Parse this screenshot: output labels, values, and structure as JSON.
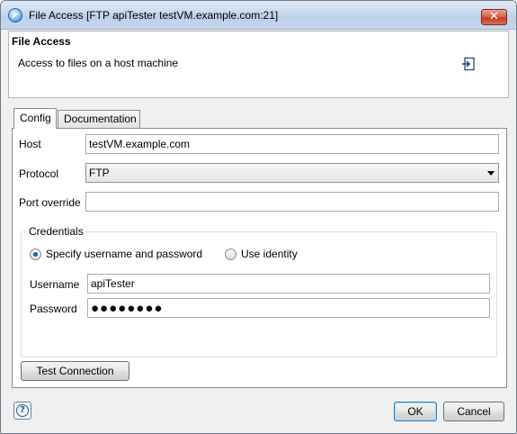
{
  "window": {
    "title": "File Access [FTP apiTester testVM.example.com:21]",
    "close_glyph": "✕"
  },
  "header": {
    "title": "File Access",
    "description": "Access to files on a host machine",
    "icon": "export-icon"
  },
  "tabs": [
    {
      "label": "Config",
      "active": true
    },
    {
      "label": "Documentation",
      "active": false
    }
  ],
  "config": {
    "host_label": "Host",
    "host_value": "testVM.example.com",
    "protocol_label": "Protocol",
    "protocol_value": "FTP",
    "port_label": "Port override",
    "port_value": "",
    "credentials": {
      "legend": "Credentials",
      "option_specify": "Specify username and password",
      "option_identity": "Use identity",
      "selected": "specify",
      "username_label": "Username",
      "username_value": "apiTester",
      "password_label": "Password",
      "password_mask": "●●●●●●●●"
    },
    "test_button": "Test Connection"
  },
  "footer": {
    "help_glyph": "?",
    "ok_label": "OK",
    "cancel_label": "Cancel"
  },
  "colors": {
    "selection_blue": "#1f5fa8",
    "titlebar": "#c8d9ee",
    "close_red": "#c53e23"
  }
}
